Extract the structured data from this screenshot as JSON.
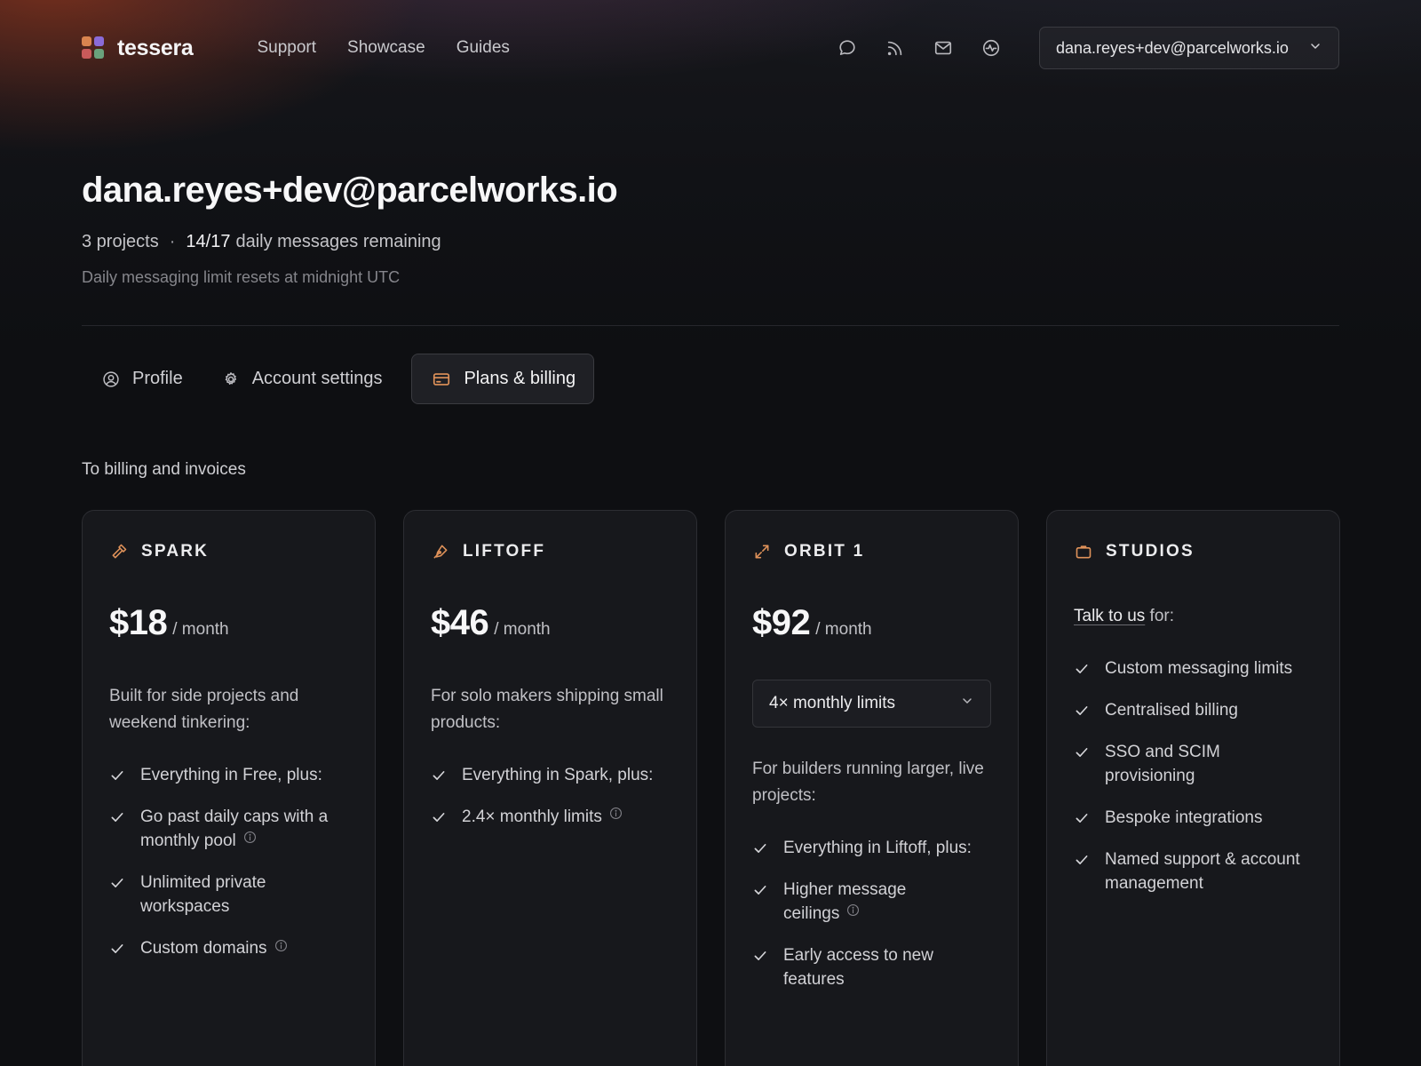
{
  "brand": {
    "name": "tessera",
    "logo_colors": [
      "#d9844f",
      "#8a6bd8",
      "#c95a5a",
      "#6aa27c"
    ]
  },
  "nav": {
    "links": [
      {
        "label": "Support"
      },
      {
        "label": "Showcase"
      },
      {
        "label": "Guides"
      }
    ],
    "icons": [
      "chat-icon",
      "rss-icon",
      "mail-icon",
      "activity-icon"
    ],
    "account_email": "dana.reyes+dev@parcelworks.io"
  },
  "header": {
    "title": "dana.reyes+dev@parcelworks.io",
    "projects": "3 projects",
    "separator": "·",
    "messages_count": "14/17",
    "messages_text": "daily messages remaining",
    "reset_note": "Daily messaging limit resets at midnight UTC"
  },
  "tabs": [
    {
      "label": "Profile",
      "icon": "user-circle-icon",
      "active": false
    },
    {
      "label": "Account settings",
      "icon": "gear-icon",
      "active": false
    },
    {
      "label": "Plans & billing",
      "icon": "credit-card-icon",
      "active": true
    }
  ],
  "billing_link": "To billing and invoices",
  "accent_color": "#e0925a",
  "plans": [
    {
      "name": "SPARK",
      "icon": "hammer-icon",
      "price": "$18",
      "period": "/ month",
      "description": "Built for side projects and weekend tinkering:",
      "features": [
        {
          "text": "Everything in Free, plus:",
          "info": false
        },
        {
          "text": "Go past daily caps with a monthly pool",
          "info": true
        },
        {
          "text": "Unlimited private workspaces",
          "info": false
        },
        {
          "text": "Custom domains",
          "info": true
        }
      ]
    },
    {
      "name": "LIFTOFF",
      "icon": "pen-nib-icon",
      "price": "$46",
      "period": "/ month",
      "description": "For solo makers shipping small products:",
      "features": [
        {
          "text": "Everything in Spark, plus:",
          "info": false
        },
        {
          "text": "2.4× monthly limits",
          "info": true
        }
      ]
    },
    {
      "name": "ORBIT 1",
      "icon": "expand-arrows-icon",
      "price": "$92",
      "period": "/ month",
      "limit_select": "4× monthly limits",
      "description": "For builders running larger, live projects:",
      "features": [
        {
          "text": "Everything in Liftoff, plus:",
          "info": false
        },
        {
          "text": "Higher message ceilings",
          "info": true
        },
        {
          "text": "Early access to new features",
          "info": false
        }
      ]
    },
    {
      "name": "STUDIOS",
      "icon": "briefcase-icon",
      "talk_link": "Talk to us",
      "talk_suffix": " for:",
      "features": [
        {
          "text": "Custom messaging limits",
          "info": false
        },
        {
          "text": "Centralised billing",
          "info": false
        },
        {
          "text": "SSO and SCIM provisioning",
          "info": false
        },
        {
          "text": "Bespoke integrations",
          "info": false
        },
        {
          "text": "Named support & account management",
          "info": false
        }
      ]
    }
  ]
}
